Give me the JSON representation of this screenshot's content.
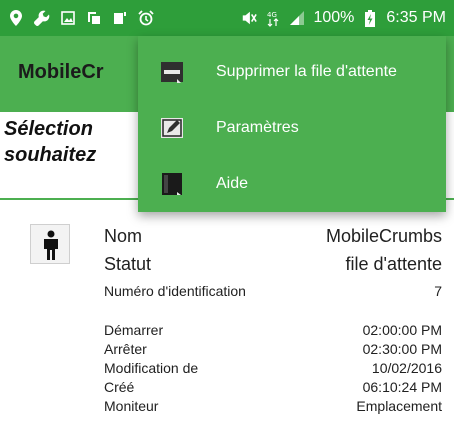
{
  "status_bar": {
    "left_icons": [
      "location-pin-icon",
      "wrench-icon",
      "image-icon",
      "screenshot-icon",
      "notification-icon",
      "alarm-icon"
    ],
    "right_icons": [
      "mute-icon",
      "data-icon",
      "signal-icon"
    ],
    "battery_text": "100%",
    "time": "6:35 PM"
  },
  "app_bar": {
    "title": "MobileCr"
  },
  "prompt": {
    "line1": "Sélection",
    "line2": "souhaitez"
  },
  "item": {
    "icon": "person-icon",
    "rows": [
      {
        "label": "Nom",
        "value": "MobileCrumbs"
      },
      {
        "label": "Statut",
        "value": "file d'attente"
      },
      {
        "label": "Numéro d'identification",
        "value": "7"
      },
      {
        "label": "Démarrer",
        "value": "02:00:00 PM"
      },
      {
        "label": "Arrêter",
        "value": "02:30:00 PM"
      },
      {
        "label": "Modification de",
        "value": "10/02/2016"
      },
      {
        "label": "Créé",
        "value": "06:10:24 PM"
      },
      {
        "label": "Moniteur",
        "value": "Emplacement"
      }
    ]
  },
  "menu": {
    "items": [
      {
        "label": "Supprimer la file d'attente",
        "icon": "delete-queue-icon"
      },
      {
        "label": "Paramètres",
        "icon": "settings-icon"
      },
      {
        "label": "Aide",
        "icon": "help-icon"
      }
    ]
  },
  "colors": {
    "status_bar": "#2e9e3a",
    "app_bar": "#4caf50",
    "menu": "#4caf50",
    "divider": "#4caf50"
  }
}
